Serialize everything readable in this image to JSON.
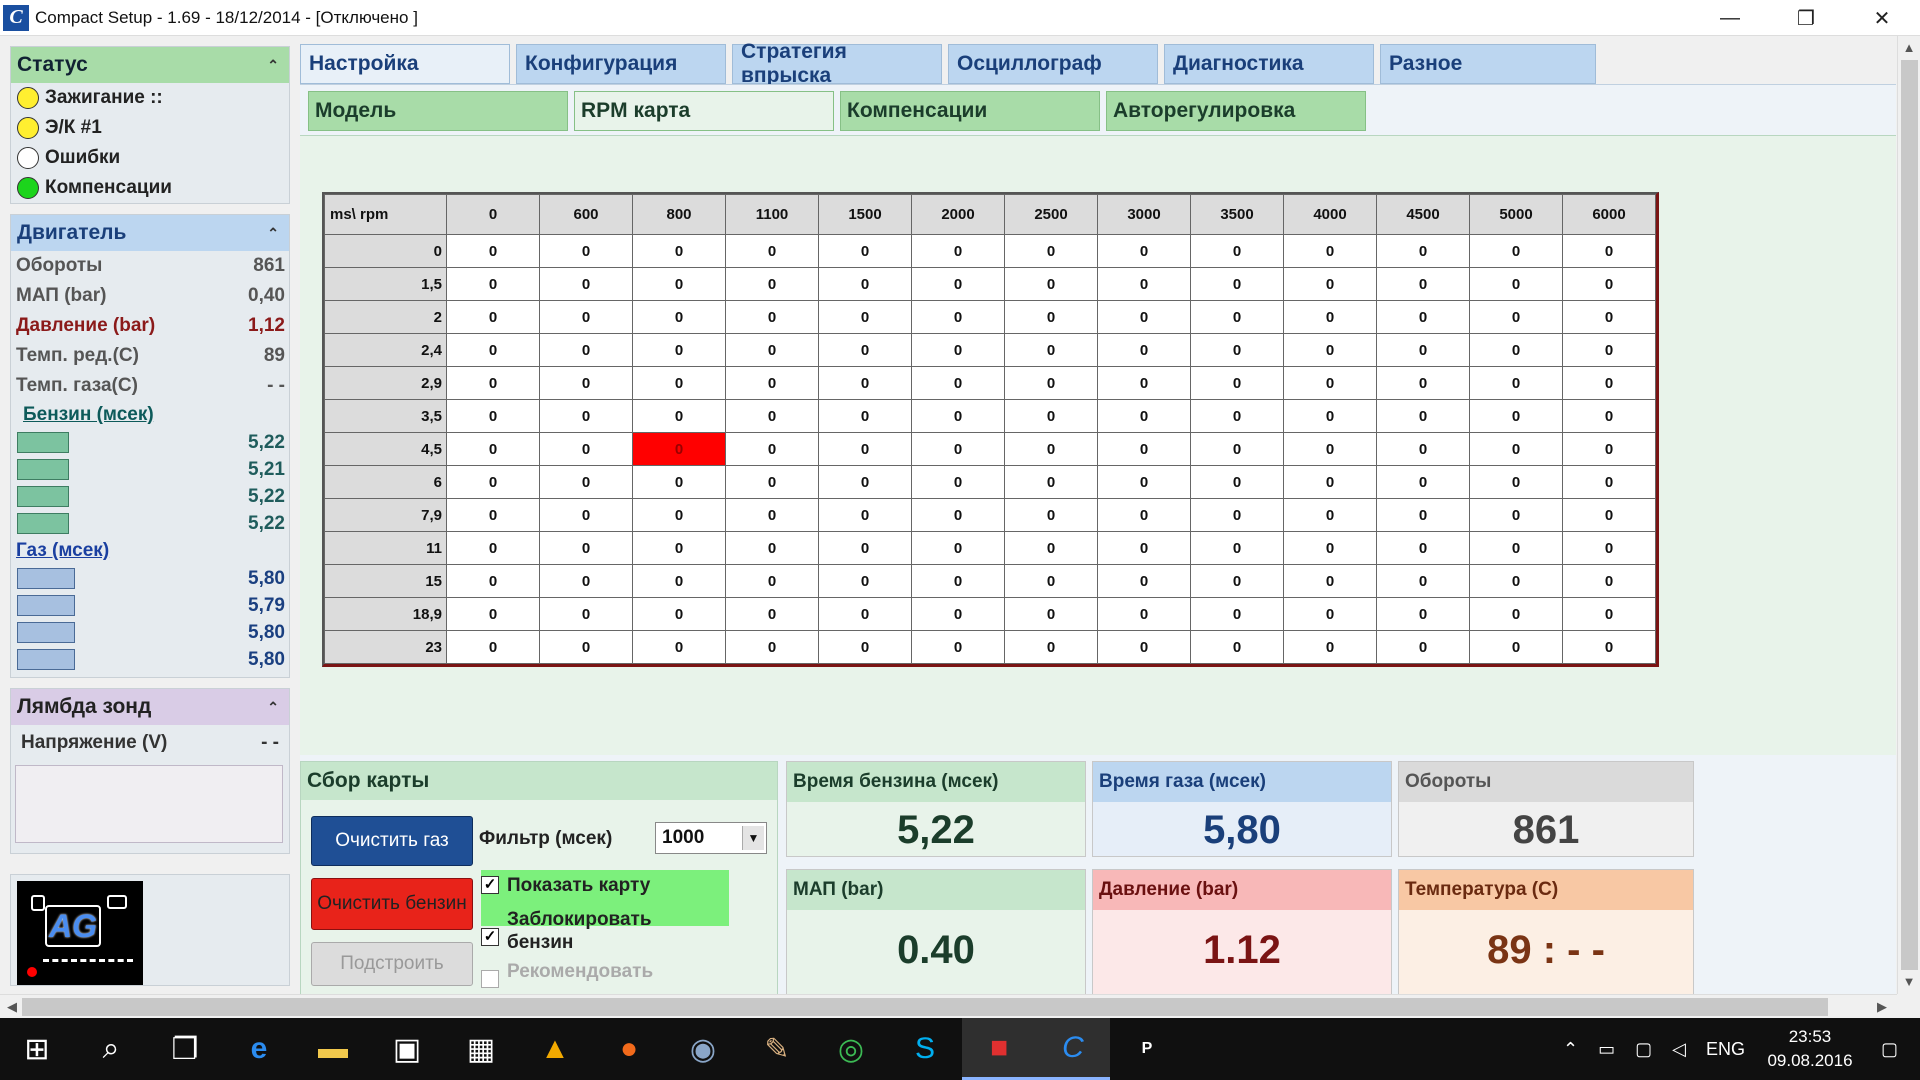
{
  "window": {
    "title": "Compact Setup - 1.69 - 18/12/2014 - [Отключено ]",
    "logo_letter": "C",
    "min": "—",
    "max": "❐",
    "close": "✕"
  },
  "status": {
    "title": "Статус",
    "items": [
      {
        "label": "Зажигание ::",
        "led": "yellow"
      },
      {
        "label": "Э/К #1",
        "led": "yellow"
      },
      {
        "label": "Ошибки",
        "led": "off"
      },
      {
        "label": "Компенсации",
        "led": "green"
      }
    ]
  },
  "engine": {
    "title": "Двигатель",
    "rows": [
      {
        "label": "Обороты",
        "value": "861"
      },
      {
        "label": "МАП (bar)",
        "value": "0,40"
      },
      {
        "label": "Давление (bar)",
        "value": "1,12"
      },
      {
        "label": "Темп. ред.(С)",
        "value": "89"
      },
      {
        "label": "Темп. газа(С)",
        "value": "- -"
      }
    ],
    "petrol_label": "Бензин (мсек)",
    "petrol_values": [
      "5,22",
      "5,21",
      "5,22",
      "5,22"
    ],
    "gas_label": "Газ (мсек)",
    "gas_values": [
      "5,80",
      "5,79",
      "5,80",
      "5,80"
    ]
  },
  "lambda": {
    "title": "Лямбда зонд",
    "voltage_label": "Напряжение (V)",
    "voltage_value": "- -"
  },
  "logo": {
    "text": "AG"
  },
  "tabs_main": [
    "Настройка",
    "Конфигурация",
    "Стратегия впрыска",
    "Осциллограф",
    "Диагностика",
    "Разное"
  ],
  "tabs_sub": [
    "Модель",
    "RPM карта",
    "Компенсации",
    "Авторегулировка"
  ],
  "map": {
    "corner": "ms\\ rpm",
    "cols": [
      "0",
      "600",
      "800",
      "1100",
      "1500",
      "2000",
      "2500",
      "3000",
      "3500",
      "4000",
      "4500",
      "5000",
      "6000"
    ],
    "rows": [
      "0",
      "1,5",
      "2",
      "2,4",
      "2,9",
      "3,5",
      "4,5",
      "6",
      "7,9",
      "11",
      "15",
      "18,9",
      "23"
    ],
    "cell_value": "0",
    "highlight": {
      "row": 6,
      "col": 2,
      "color": "#ff0000"
    }
  },
  "collect": {
    "title": "Сбор карты",
    "clear_gas": "Очистить газ",
    "clear_petrol": "Очистить бензин",
    "build": "Подстроить",
    "filter_label": "Фильтр (мсек)",
    "filter_value": "1000",
    "show_map": "Показать карту",
    "lock_petrol": "Заблокировать бензин",
    "recommend": "Рекомендовать"
  },
  "values": {
    "petrol_time": {
      "label": "Время бензина (мсек)",
      "value": "5,22"
    },
    "gas_time": {
      "label": "Время газа (мсек)",
      "value": "5,80"
    },
    "rpm": {
      "label": "Обороты",
      "value": "861"
    },
    "map": {
      "label": "МАП (bar)",
      "value": "0.40"
    },
    "pressure": {
      "label": "Давление (bar)",
      "value": "1.12"
    },
    "temperature": {
      "label": "Температура (С)",
      "value": "89 :  - -"
    }
  },
  "taskbar": {
    "lang": "ENG",
    "time": "23:53",
    "date": "09.08.2016"
  }
}
